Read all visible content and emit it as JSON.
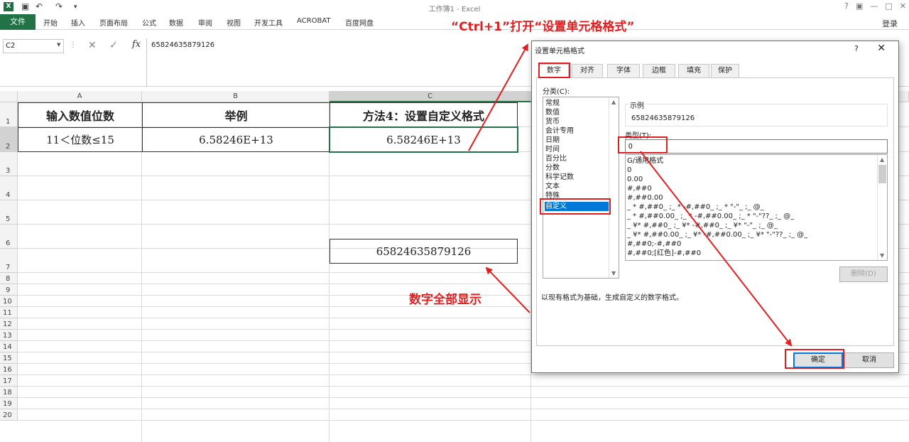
{
  "app": {
    "window_title": "工作簿1 - Excel",
    "logo": "X",
    "qat_icons": [
      "save-icon",
      "undo-icon",
      "redo-icon",
      "customize-icon"
    ]
  },
  "ribbon": {
    "tabs": [
      "文件",
      "开始",
      "插入",
      "页面布局",
      "公式",
      "数据",
      "审阅",
      "视图",
      "开发工具",
      "ACROBAT",
      "百度网盘"
    ],
    "login": "登录"
  },
  "annotations": {
    "ctrl": "“Ctrl+1”打开“设置单元格格式”",
    "show": "数字全部显示",
    "color": "#e02020"
  },
  "formula_bar": {
    "name_box": "C2",
    "fx": "fx",
    "content": "65824635879126"
  },
  "columns": [
    "A",
    "B",
    "C"
  ],
  "rows": [
    "1",
    "2",
    "3",
    "4",
    "5",
    "6",
    "7",
    "8",
    "9",
    "10",
    "11",
    "12",
    "13",
    "14",
    "15",
    "16",
    "17",
    "18",
    "19",
    "20"
  ],
  "cells": {
    "a1": "输入数值位数",
    "b1": "举例",
    "c1": "方法4：设置自定义格式",
    "a2": "11＜位数≤15",
    "b2": "6.58246E+13",
    "c2": "6.58246E+13",
    "c6": "65824635879126"
  },
  "dialog": {
    "title": "设置单元格格式",
    "help": "?",
    "close": "✕",
    "tabs": [
      "数字",
      "对齐",
      "字体",
      "边框",
      "填充",
      "保护"
    ],
    "active_tab": "数字",
    "category_label": "分类(C):",
    "categories": [
      "常规",
      "数值",
      "货币",
      "会计专用",
      "日期",
      "时间",
      "百分比",
      "分数",
      "科学记数",
      "文本",
      "特殊",
      "自定义"
    ],
    "selected_category": "自定义",
    "sample_label": "示例",
    "sample_value": "65824635879126",
    "type_label": "类型(T):",
    "type_value": "0",
    "formats": [
      "G/通用格式",
      "0",
      "0.00",
      "#,##0",
      "#,##0.00",
      "_ * #,##0_ ;_ * -#,##0_ ;_ * \"-\"_ ;_ @_",
      "_ * #,##0.00_ ;_ * -#,##0.00_ ;_ * \"-\"??_ ;_ @_",
      "_ ¥* #,##0_ ;_ ¥* -#,##0_ ;_ ¥* \"-\"_ ;_ @_",
      "_ ¥* #,##0.00_ ;_ ¥* -#,##0.00_ ;_ ¥* \"-\"??_ ;_ @_",
      "#,##0;-#,##0",
      "#,##0;[红色]-#,##0"
    ],
    "delete_label": "删除(D)",
    "description": "以现有格式为基础，生成自定义的数字格式。",
    "ok_label": "确定",
    "cancel_label": "取消"
  }
}
